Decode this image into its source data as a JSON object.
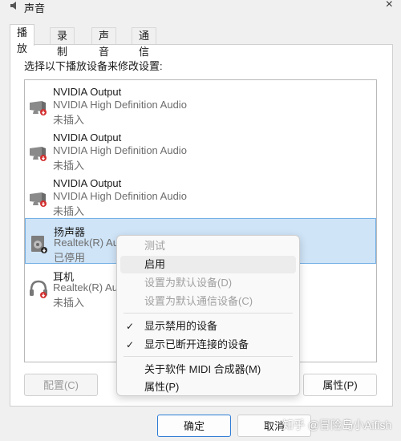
{
  "window": {
    "title": "声音",
    "close_glyph": "×"
  },
  "tabs": [
    {
      "label": "播放",
      "active": true
    },
    {
      "label": "录制",
      "active": false
    },
    {
      "label": "声音",
      "active": false
    },
    {
      "label": "通信",
      "active": false
    }
  ],
  "instruction": "选择以下播放设备来修改设置:",
  "devices": [
    {
      "name": "NVIDIA Output",
      "driver": "NVIDIA High Definition Audio",
      "status": "未插入",
      "icon": "monitor-speaker-icon",
      "badge": "unplugged"
    },
    {
      "name": "NVIDIA Output",
      "driver": "NVIDIA High Definition Audio",
      "status": "未插入",
      "icon": "monitor-speaker-icon",
      "badge": "unplugged"
    },
    {
      "name": "NVIDIA Output",
      "driver": "NVIDIA High Definition Audio",
      "status": "未插入",
      "icon": "monitor-speaker-icon",
      "badge": "unplugged"
    },
    {
      "name": "扬声器",
      "driver": "Realtek(R) Au",
      "status": "已停用",
      "icon": "speaker-icon",
      "badge": "disabled",
      "selected": true
    },
    {
      "name": "耳机",
      "driver": "Realtek(R) Au",
      "status": "未插入",
      "icon": "headphones-icon",
      "badge": "unplugged"
    }
  ],
  "buttons": {
    "configure": "配置(C)",
    "properties": "属性(P)",
    "ok": "确定",
    "cancel": "取消"
  },
  "context_menu": [
    {
      "label": "测试",
      "disabled": true
    },
    {
      "label": "启用",
      "hover": true
    },
    {
      "label": "设置为默认设备(D)",
      "disabled": true
    },
    {
      "label": "设置为默认通信设备(C)",
      "disabled": true
    },
    {
      "label": "显示禁用的设备",
      "checked": true
    },
    {
      "label": "显示已断开连接的设备",
      "checked": true
    },
    {
      "label": "关于软件 MIDI 合成器(M)"
    },
    {
      "label": "属性(P)"
    }
  ],
  "watermark": "知乎 @冒险岛小Aifish",
  "colors": {
    "selection_bg": "#cfe4f7",
    "selection_border": "#73b0e6",
    "badge_red": "#d32f2f"
  }
}
